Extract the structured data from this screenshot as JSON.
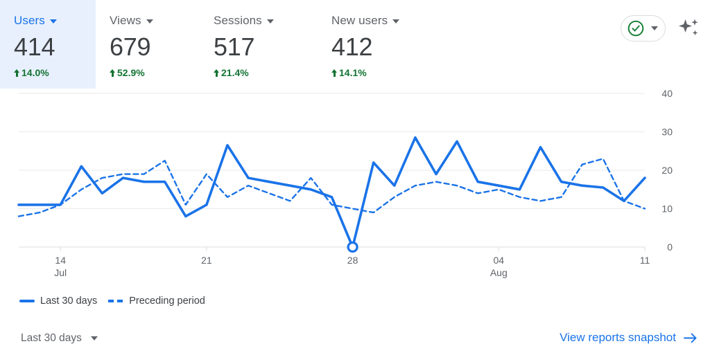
{
  "metrics": [
    {
      "label": "Users",
      "value": "414",
      "delta": "14.0%",
      "trend": "up",
      "selected": true
    },
    {
      "label": "Views",
      "value": "679",
      "delta": "52.9%",
      "trend": "up",
      "selected": false
    },
    {
      "label": "Sessions",
      "value": "517",
      "delta": "21.4%",
      "trend": "up",
      "selected": false
    },
    {
      "label": "New users",
      "value": "412",
      "delta": "14.1%",
      "trend": "up",
      "selected": false
    }
  ],
  "topright": {
    "status_icon": "check-circle-green-icon",
    "dropdown_icon": "chevron-down-icon",
    "ai_icon": "sparkle-icon"
  },
  "legend": [
    {
      "label": "Last 30 days",
      "style": "solid"
    },
    {
      "label": "Preceding period",
      "style": "dashed"
    }
  ],
  "footer": {
    "date_range_label": "Last 30 days",
    "date_range_icon": "chevron-down-icon",
    "snapshot_label": "View reports snapshot",
    "snapshot_icon": "arrow-right-icon"
  },
  "colors": {
    "accent_blue": "#1a73e8",
    "positive_green": "#137333",
    "selected_card_bg": "#e8f0fe",
    "text_grey": "#5f6368",
    "gridline": "#e8eaed"
  },
  "chart_data": {
    "type": "line",
    "title": "",
    "xlabel": "",
    "ylabel": "",
    "ylim": [
      0,
      40
    ],
    "yticks": [
      0,
      10,
      20,
      30,
      40
    ],
    "grid": true,
    "legend_position": "bottom-left",
    "x_tick_labels": [
      {
        "day": "14",
        "month": "Jul",
        "index": 2
      },
      {
        "day": "21",
        "month": "",
        "index": 9
      },
      {
        "day": "28",
        "month": "",
        "index": 16
      },
      {
        "day": "04",
        "month": "Aug",
        "index": 23
      },
      {
        "day": "11",
        "month": "",
        "index": 30
      }
    ],
    "x": [
      "Jul 12",
      "Jul 13",
      "Jul 14",
      "Jul 15",
      "Jul 16",
      "Jul 17",
      "Jul 18",
      "Jul 19",
      "Jul 20",
      "Jul 21",
      "Jul 22",
      "Jul 23",
      "Jul 24",
      "Jul 25",
      "Jul 26",
      "Jul 27",
      "Jul 28",
      "Jul 29",
      "Jul 30",
      "Jul 31",
      "Aug 01",
      "Aug 02",
      "Aug 03",
      "Aug 04",
      "Aug 05",
      "Aug 06",
      "Aug 07",
      "Aug 08",
      "Aug 09",
      "Aug 10",
      "Aug 11"
    ],
    "series": [
      {
        "name": "Last 30 days",
        "style": "solid",
        "color": "#1a73e8",
        "marker_index": 16,
        "marker_value": 0,
        "values": [
          11,
          11,
          11,
          21,
          14,
          18,
          17,
          17,
          8,
          11,
          26.5,
          18,
          17,
          16,
          15,
          13,
          0,
          22,
          16,
          28.5,
          19,
          27.5,
          17,
          16,
          15,
          26,
          17,
          16,
          15.5,
          12,
          18
        ]
      },
      {
        "name": "Preceding period",
        "style": "dashed",
        "color": "#1a73e8",
        "values": [
          8,
          9,
          11,
          15,
          18,
          19,
          19,
          22.5,
          11,
          19,
          13,
          16,
          14,
          12,
          18,
          11,
          10,
          9,
          13,
          16,
          17,
          16,
          14,
          15,
          13,
          12,
          13,
          21.5,
          23,
          12,
          10
        ]
      }
    ]
  }
}
